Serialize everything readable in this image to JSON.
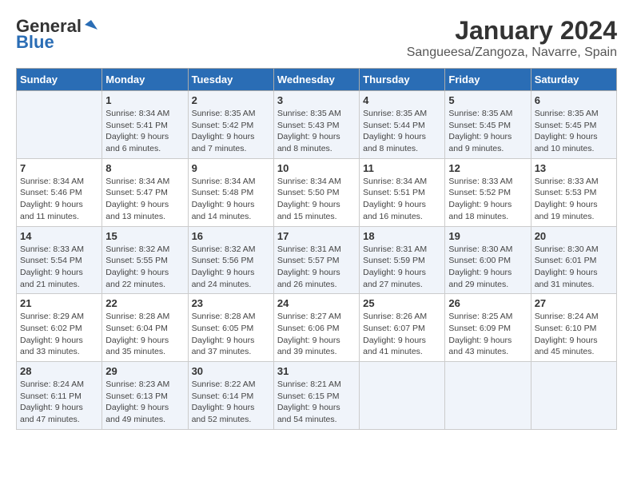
{
  "header": {
    "logo_general": "General",
    "logo_blue": "Blue",
    "month_title": "January 2024",
    "location": "Sangueesa/Zangoza, Navarre, Spain"
  },
  "days_of_week": [
    "Sunday",
    "Monday",
    "Tuesday",
    "Wednesday",
    "Thursday",
    "Friday",
    "Saturday"
  ],
  "weeks": [
    [
      {
        "day": "",
        "content": ""
      },
      {
        "day": "1",
        "content": "Sunrise: 8:34 AM\nSunset: 5:41 PM\nDaylight: 9 hours\nand 6 minutes."
      },
      {
        "day": "2",
        "content": "Sunrise: 8:35 AM\nSunset: 5:42 PM\nDaylight: 9 hours\nand 7 minutes."
      },
      {
        "day": "3",
        "content": "Sunrise: 8:35 AM\nSunset: 5:43 PM\nDaylight: 9 hours\nand 8 minutes."
      },
      {
        "day": "4",
        "content": "Sunrise: 8:35 AM\nSunset: 5:44 PM\nDaylight: 9 hours\nand 8 minutes."
      },
      {
        "day": "5",
        "content": "Sunrise: 8:35 AM\nSunset: 5:45 PM\nDaylight: 9 hours\nand 9 minutes."
      },
      {
        "day": "6",
        "content": "Sunrise: 8:35 AM\nSunset: 5:45 PM\nDaylight: 9 hours\nand 10 minutes."
      }
    ],
    [
      {
        "day": "7",
        "content": "Sunrise: 8:34 AM\nSunset: 5:46 PM\nDaylight: 9 hours\nand 11 minutes."
      },
      {
        "day": "8",
        "content": "Sunrise: 8:34 AM\nSunset: 5:47 PM\nDaylight: 9 hours\nand 13 minutes."
      },
      {
        "day": "9",
        "content": "Sunrise: 8:34 AM\nSunset: 5:48 PM\nDaylight: 9 hours\nand 14 minutes."
      },
      {
        "day": "10",
        "content": "Sunrise: 8:34 AM\nSunset: 5:50 PM\nDaylight: 9 hours\nand 15 minutes."
      },
      {
        "day": "11",
        "content": "Sunrise: 8:34 AM\nSunset: 5:51 PM\nDaylight: 9 hours\nand 16 minutes."
      },
      {
        "day": "12",
        "content": "Sunrise: 8:33 AM\nSunset: 5:52 PM\nDaylight: 9 hours\nand 18 minutes."
      },
      {
        "day": "13",
        "content": "Sunrise: 8:33 AM\nSunset: 5:53 PM\nDaylight: 9 hours\nand 19 minutes."
      }
    ],
    [
      {
        "day": "14",
        "content": "Sunrise: 8:33 AM\nSunset: 5:54 PM\nDaylight: 9 hours\nand 21 minutes."
      },
      {
        "day": "15",
        "content": "Sunrise: 8:32 AM\nSunset: 5:55 PM\nDaylight: 9 hours\nand 22 minutes."
      },
      {
        "day": "16",
        "content": "Sunrise: 8:32 AM\nSunset: 5:56 PM\nDaylight: 9 hours\nand 24 minutes."
      },
      {
        "day": "17",
        "content": "Sunrise: 8:31 AM\nSunset: 5:57 PM\nDaylight: 9 hours\nand 26 minutes."
      },
      {
        "day": "18",
        "content": "Sunrise: 8:31 AM\nSunset: 5:59 PM\nDaylight: 9 hours\nand 27 minutes."
      },
      {
        "day": "19",
        "content": "Sunrise: 8:30 AM\nSunset: 6:00 PM\nDaylight: 9 hours\nand 29 minutes."
      },
      {
        "day": "20",
        "content": "Sunrise: 8:30 AM\nSunset: 6:01 PM\nDaylight: 9 hours\nand 31 minutes."
      }
    ],
    [
      {
        "day": "21",
        "content": "Sunrise: 8:29 AM\nSunset: 6:02 PM\nDaylight: 9 hours\nand 33 minutes."
      },
      {
        "day": "22",
        "content": "Sunrise: 8:28 AM\nSunset: 6:04 PM\nDaylight: 9 hours\nand 35 minutes."
      },
      {
        "day": "23",
        "content": "Sunrise: 8:28 AM\nSunset: 6:05 PM\nDaylight: 9 hours\nand 37 minutes."
      },
      {
        "day": "24",
        "content": "Sunrise: 8:27 AM\nSunset: 6:06 PM\nDaylight: 9 hours\nand 39 minutes."
      },
      {
        "day": "25",
        "content": "Sunrise: 8:26 AM\nSunset: 6:07 PM\nDaylight: 9 hours\nand 41 minutes."
      },
      {
        "day": "26",
        "content": "Sunrise: 8:25 AM\nSunset: 6:09 PM\nDaylight: 9 hours\nand 43 minutes."
      },
      {
        "day": "27",
        "content": "Sunrise: 8:24 AM\nSunset: 6:10 PM\nDaylight: 9 hours\nand 45 minutes."
      }
    ],
    [
      {
        "day": "28",
        "content": "Sunrise: 8:24 AM\nSunset: 6:11 PM\nDaylight: 9 hours\nand 47 minutes."
      },
      {
        "day": "29",
        "content": "Sunrise: 8:23 AM\nSunset: 6:13 PM\nDaylight: 9 hours\nand 49 minutes."
      },
      {
        "day": "30",
        "content": "Sunrise: 8:22 AM\nSunset: 6:14 PM\nDaylight: 9 hours\nand 52 minutes."
      },
      {
        "day": "31",
        "content": "Sunrise: 8:21 AM\nSunset: 6:15 PM\nDaylight: 9 hours\nand 54 minutes."
      },
      {
        "day": "",
        "content": ""
      },
      {
        "day": "",
        "content": ""
      },
      {
        "day": "",
        "content": ""
      }
    ]
  ]
}
